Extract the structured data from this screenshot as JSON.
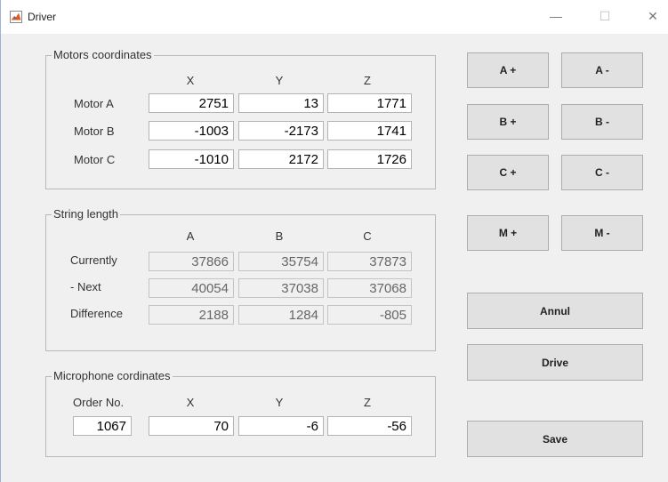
{
  "window": {
    "title": "Driver",
    "controls": {
      "minimize": "—",
      "maximize": "☐",
      "close": "✕"
    }
  },
  "motors": {
    "title": "Motors coordinates",
    "headers": [
      "X",
      "Y",
      "Z"
    ],
    "rows": [
      {
        "label": "Motor A",
        "values": [
          "2751",
          "13",
          "1771"
        ]
      },
      {
        "label": "Motor B",
        "values": [
          "-1003",
          "-2173",
          "1741"
        ]
      },
      {
        "label": "Motor C",
        "values": [
          "-1010",
          "2172",
          "1726"
        ]
      }
    ]
  },
  "string": {
    "title": "String length",
    "headers": [
      "A",
      "B",
      "C"
    ],
    "rows": [
      {
        "label": "Currently",
        "values": [
          "37866",
          "35754",
          "37873"
        ]
      },
      {
        "label": "- Next",
        "values": [
          "40054",
          "37038",
          "37068"
        ]
      },
      {
        "label": "Difference",
        "values": [
          "2188",
          "1284",
          "-805"
        ]
      }
    ]
  },
  "mic": {
    "title": "Microphone cordinates",
    "headers": [
      "Order No.",
      "X",
      "Y",
      "Z"
    ],
    "values": [
      "1067",
      "70",
      "-6",
      "-56"
    ]
  },
  "buttons": {
    "a_plus": "A +",
    "a_minus": "A -",
    "b_plus": "B +",
    "b_minus": "B -",
    "c_plus": "C +",
    "c_minus": "C -",
    "m_plus": "M +",
    "m_minus": "M -",
    "annul": "Annul",
    "drive": "Drive",
    "save": "Save"
  },
  "colors": {
    "background": "#f0f0f0",
    "button": "#e1e1e1",
    "app_icon": "#e35a1e"
  },
  "icons": {
    "app": "matlab-figure-icon"
  }
}
